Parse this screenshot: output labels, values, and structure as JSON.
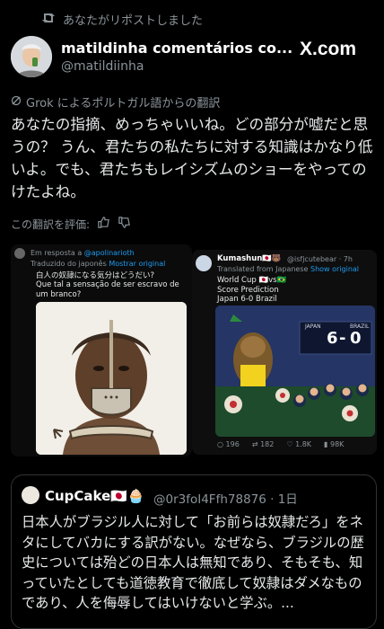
{
  "repost": {
    "text": "あなたがリポストしました"
  },
  "post": {
    "author_name": "matildinha comentários co...",
    "author_handle": "@matildiinha",
    "site_label": "X.com",
    "translation_notice": "Grok によるポルトガル語からの翻訳",
    "body": "あなたの指摘、めっちゃいいね。どの部分が嘘だと思うの？ うん、君たちの私たちに対する知識はかなり低いよ。でも、君たちもレイシズムのショーをやってのけたよね。",
    "rate_label": "この翻訳を評価:"
  },
  "left_card": {
    "reply_prefix": "Em resposta a",
    "reply_handle": "@apolinarioth",
    "translated_label": "Traduzido do japonês",
    "show_original": "Mostrar original",
    "line1": "白人の奴隷になる気分はどうだい?",
    "line2": "Que tal a sensação de ser escravo de um branco?"
  },
  "right_card": {
    "name": "Kumashun🇯🇵🐻",
    "handle_time": "@isfjcutebear · 7h",
    "translated_label": "Translated from Japanese",
    "show_original": "Show original",
    "title": "World Cup 🇯🇵vs🇧🇷",
    "subtitle": "Score Prediction",
    "prediction": "Japan 6-0 Brazil",
    "score_home_label": "JAPAN",
    "score_away_label": "BRAZIL",
    "score_home": "6",
    "score_away": "0",
    "stats": {
      "replies": "196",
      "reposts": "182",
      "likes": "1.8K",
      "views": "98K"
    }
  },
  "quote": {
    "name": "CupCake🇯🇵🧁",
    "handle_time": "@0r3foI4Ffh78876 · 1日",
    "body": "日本人がブラジル人に対して「お前らは奴隷だろ」をネタにしてバカにする訳がない。なぜなら、ブラジルの歴史については殆どの日本人は無知であり、そもそも、知っていたとしても道徳教育で徹底して奴隷はダメなものであり、人を侮辱してはいけないと学ぶ。..."
  },
  "colors": {
    "background": "#000000",
    "text": "#e7e9ea",
    "muted": "#8b949a",
    "link": "#1d9bf0",
    "border": "#2f3336"
  }
}
